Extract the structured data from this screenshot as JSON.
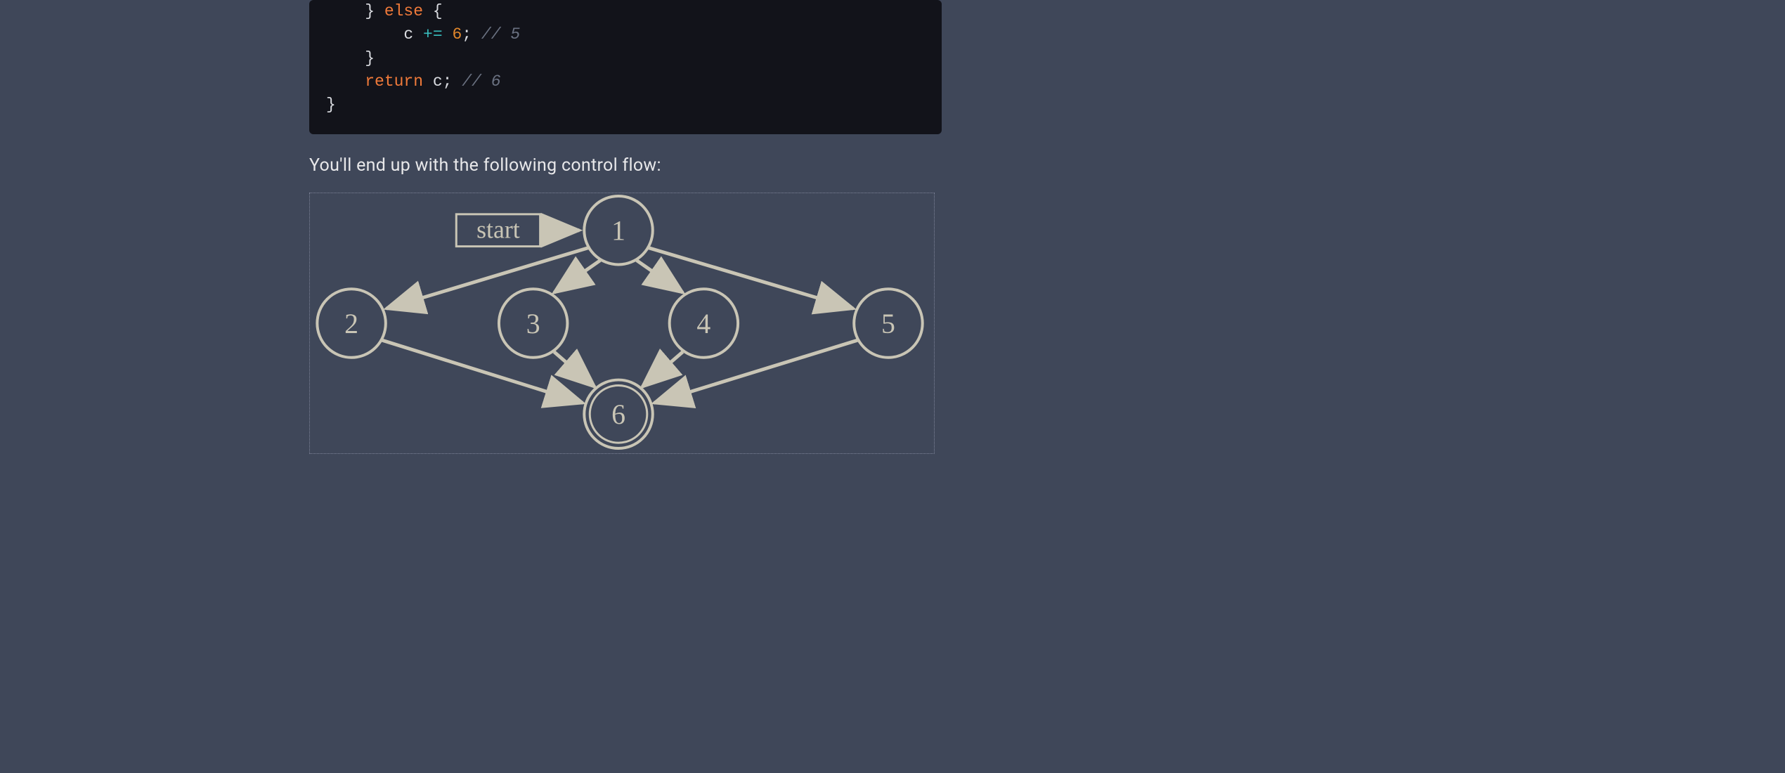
{
  "code": {
    "line1_open": "    } ",
    "line1_else": "else",
    "line1_brace": " {",
    "line2_indent": "        ",
    "line2_ident": "c",
    "line2_space": " ",
    "line2_op": "+=",
    "line2_space2": " ",
    "line2_num": "6",
    "line2_semi": ";",
    "line2_space3": " ",
    "line2_comment": "// 5",
    "line3": "    }",
    "line4_indent": "    ",
    "line4_return": "return",
    "line4_space": " ",
    "line4_ident": "c",
    "line4_semi": ";",
    "line4_space2": " ",
    "line4_comment": "// 6",
    "line5": "}"
  },
  "body": {
    "text": "You'll end up with the following control flow:"
  },
  "diagram": {
    "start_label": "start",
    "nodes": {
      "n1": "1",
      "n2": "2",
      "n3": "3",
      "n4": "4",
      "n5": "5",
      "n6": "6"
    },
    "edges_desc": "start→1; 1→2; 1→3; 1→4; 1→5; 2→6; 3→6; 4→6; 5→6",
    "colors": {
      "stroke": "#c9c5b5",
      "text": "#c9c5b5"
    }
  }
}
